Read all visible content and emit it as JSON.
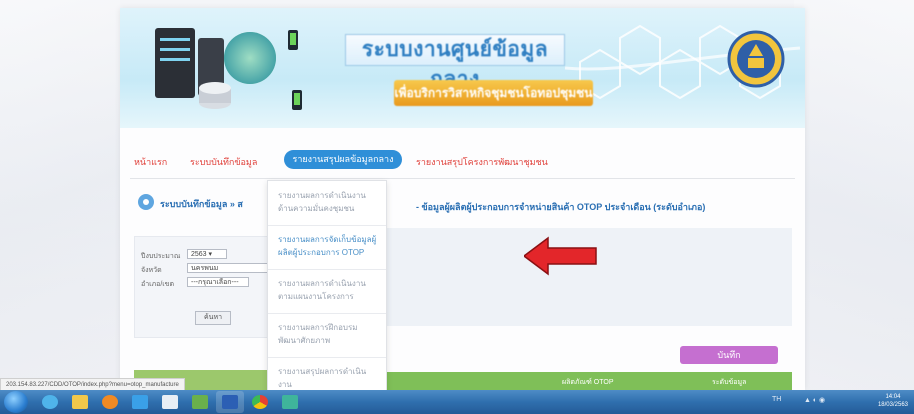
{
  "header": {
    "title": "ระบบงานศูนย์ข้อมูลกลาง",
    "subtitle": "เพื่อบริการวิสาหกิจชุมชนโอทอปชุมชน"
  },
  "nav": {
    "items": [
      "หน้าแรก",
      "ระบบบันทึกข้อมูล",
      "รายงานสรุปผลข้อมูลกลาง",
      "รายงานสรุปโครงการพัฒนาชุมชน"
    ],
    "active_index": 2
  },
  "sidebar": {
    "title": "ระบบบันทึกข้อมูล » ส"
  },
  "form": {
    "year_label": "ปีงบประมาณ",
    "year_value": "2563 ▾",
    "province_label": "จังหวัด",
    "province_value": "นครพนม",
    "district_label": "อำเภอ/เขต",
    "district_value": "---กรุณาเลือก---",
    "search_button": "ค้นหา"
  },
  "main": {
    "title": "- ข้อมูลผู้ผลิตผู้ประกอบการจำหน่ายสินค้า OTOP ประจำเดือน (ระดับอำเภอ)",
    "save_button": "บันทึก",
    "table_headers": [
      "ผลิตภัณฑ์ OTOP",
      "ระดับข้อมูล"
    ]
  },
  "dropdown": {
    "items": [
      "รายงานผลการดำเนินงานด้านความมั่นคงชุมชน",
      "รายงานผลการจัดเก็บข้อมูลผู้ผลิตผู้ประกอบการ OTOP",
      "รายงานผลการดำเนินงานตามแผนงานโครงการ",
      "รายงานผลการฝึกอบรมพัฒนาศักยภาพ",
      "รายงานสรุปผลการดำเนินงาน"
    ],
    "highlight_index": 1
  },
  "status_bar": {
    "url": "203.154.83.227/CDD/OTOP/index.php?menu=otop_manufacture"
  },
  "taskbar": {
    "tray_lang": "TH",
    "time": "14:04",
    "date": "18/03/2563"
  },
  "colors": {
    "nav_active": "#2f8fd8",
    "nav_text": "#e0403a",
    "save_button": "#c56fd0",
    "table_header": "#7fbf58",
    "arrow": "#e3262a",
    "taskbar": "#2f6fae"
  }
}
